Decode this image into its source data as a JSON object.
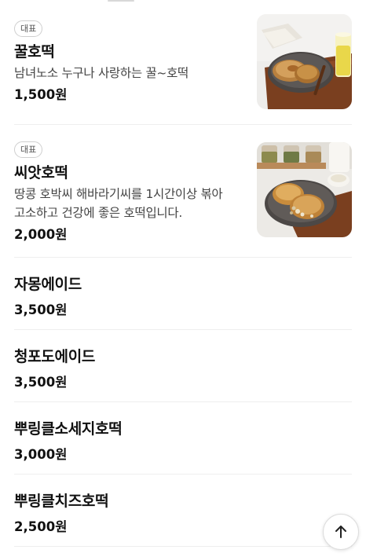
{
  "menu_items": [
    {
      "badge": "대표",
      "name": "꿀호떡",
      "description": [
        "남녀노소 누구나 사랑하는 꿀~호떡"
      ],
      "price": "1,500원",
      "image": "honey-hotteok-photo"
    },
    {
      "badge": "대표",
      "name": "씨앗호떡",
      "description": [
        "땅콩 호박씨 해바라기씨를 1시간이상 볶아",
        "고소하고 건강에 좋은 호떡입니다."
      ],
      "price": "2,000원",
      "image": "seed-hotteok-photo"
    },
    {
      "name": "자몽에이드",
      "price": "3,500원"
    },
    {
      "name": "청포도에이드",
      "price": "3,500원"
    },
    {
      "name": "뿌링클소세지호떡",
      "price": "3,000원"
    },
    {
      "name": "뿌링클치즈호떡",
      "price": "2,500원"
    }
  ],
  "scroll_top_button": {
    "icon": "arrow-up-icon"
  }
}
